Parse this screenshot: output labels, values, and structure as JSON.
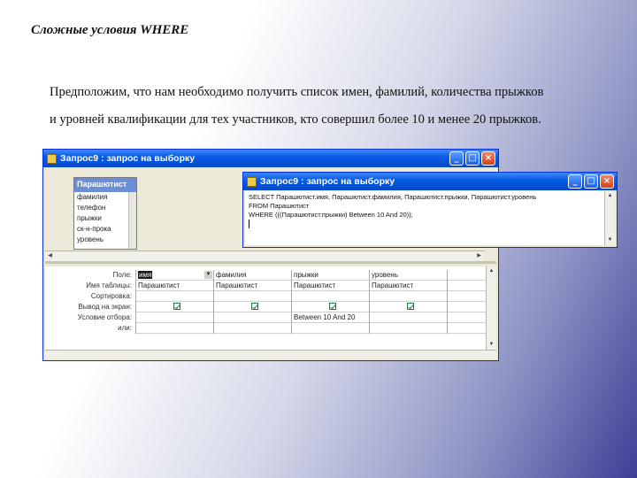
{
  "slide": {
    "title": "Сложные условия WHERE",
    "line1": "Предположим, что нам необходимо получить список имен, фамилий, количества прыжков",
    "line2": "и уровней квалификации для тех участников, кто совершил более 10 и менее 20 прыжков."
  },
  "main_window": {
    "title": "Запрос9 : запрос на выборку",
    "minimize": "_",
    "maximize": "□",
    "close": "×"
  },
  "field_list": {
    "title": "Парашютист",
    "items": [
      "фамилия",
      "телефон",
      "прыжки",
      "ск-н-прока",
      "уровень"
    ]
  },
  "grid": {
    "row_labels": [
      "Поле:",
      "Имя таблицы:",
      "Сортировка:",
      "Вывод на экран:",
      "Условие отбора:",
      "или:"
    ],
    "columns": [
      {
        "field": "имя",
        "table": "Парашютист",
        "criteria": ""
      },
      {
        "field": "фамилия",
        "table": "Парашютист",
        "criteria": ""
      },
      {
        "field": "прыжки",
        "table": "Парашютист",
        "criteria": "Between 10 And 20"
      },
      {
        "field": "уровень",
        "table": "Парашютист",
        "criteria": ""
      }
    ]
  },
  "sql_window": {
    "title": "Запрос9 : запрос на выборку",
    "minimize": "_",
    "maximize": "□",
    "close": "×",
    "lines": [
      "SELECT Парашютист.имя, Парашютист.фамилия, Парашютист.прыжки, Парашютист.уровень",
      "FROM Парашютист",
      "WHERE (((Парашютист.прыжки) Between 10 And 20));"
    ]
  }
}
